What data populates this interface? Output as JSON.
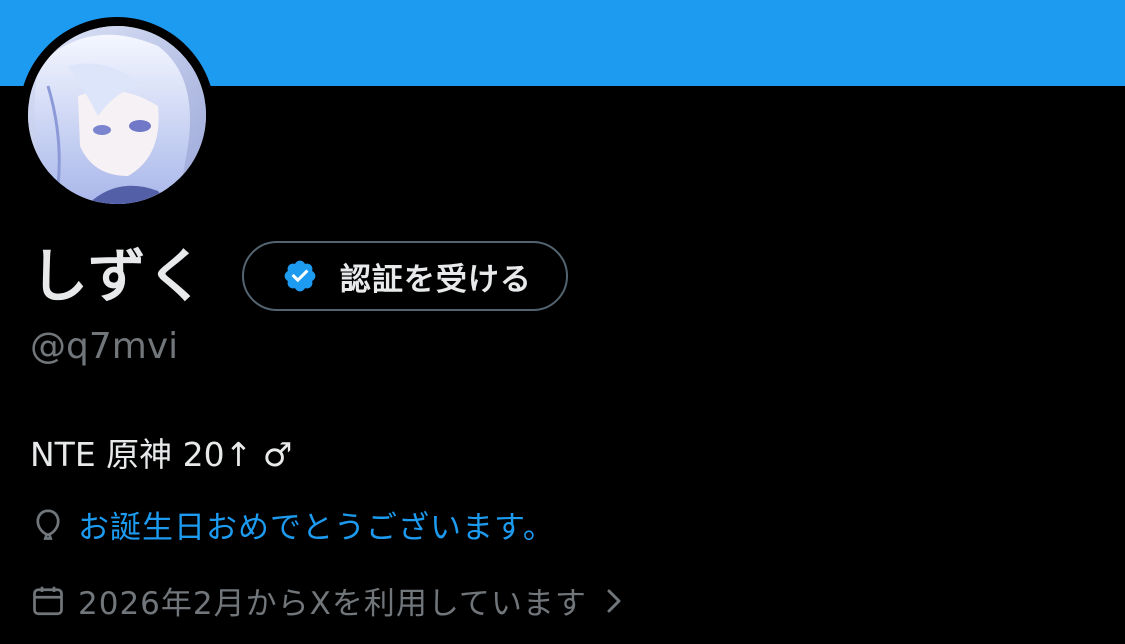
{
  "header": {
    "banner_color": "#1d9bf0"
  },
  "profile": {
    "display_name": "しずく",
    "handle": "@q7mvi",
    "verify_button_label": "認証を受ける",
    "bio": "NTE 原神 20↑ ♂",
    "birthday_text": "お誕生日おめでとうございます。",
    "joined_text": "2026年2月からXを利用しています"
  },
  "icons": {
    "avatar": "avatar-image",
    "verify": "verified-badge-icon",
    "birthday": "balloon-icon",
    "joined": "calendar-icon",
    "chevron": "chevron-right-icon"
  },
  "colors": {
    "accent": "#1d9bf0",
    "text_primary": "#e7e9ea",
    "text_secondary": "#71767b",
    "background": "#000000"
  }
}
